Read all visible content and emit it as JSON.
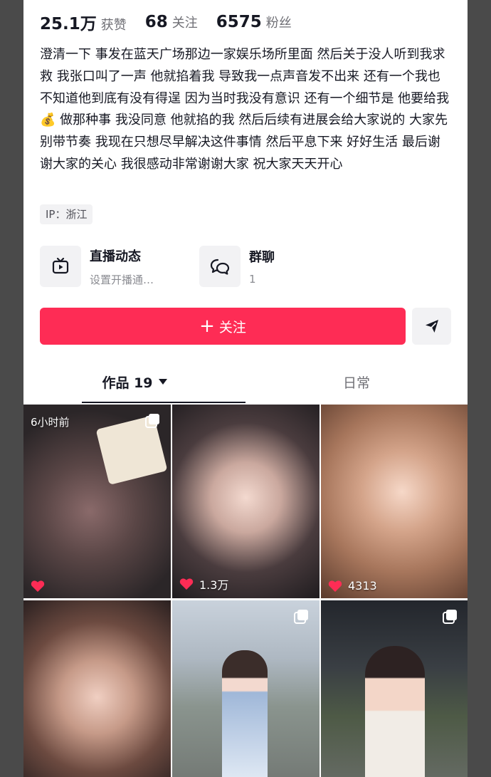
{
  "profile": {
    "stats": [
      {
        "value": "25.1万",
        "label": "获赞"
      },
      {
        "value": "68",
        "label": "关注"
      },
      {
        "value": "6575",
        "label": "粉丝"
      }
    ],
    "bio": "澄清一下 事发在蓝天广场那边一家娱乐场所里面 然后关于没人听到我求救 我张口叫了一声 他就掐着我 导致我一点声音发不出来 还有一个我也不知道他到底有没有得逞 因为当时我没有意识 还有一个细节是 他要给我💰 做那种事 我没同意 他就掐的我 然后后续有进展会给大家说的 大家先别带节奏 我现在只想尽早解决这件事情 然后平息下来 好好生活 最后谢谢大家的关心 我很感动非常谢谢大家 祝大家天天开心",
    "ip": "IP：浙江"
  },
  "features": {
    "live": {
      "title": "直播动态",
      "subtitle": "设置开播通…",
      "icon": "tv-play-icon"
    },
    "group": {
      "title": "群聊",
      "subtitle": "1",
      "icon": "chat-bubbles-icon"
    }
  },
  "actions": {
    "follow_label": "关注",
    "share_icon": "send-icon"
  },
  "tabs": {
    "works": "作品 19",
    "daily": "日常"
  },
  "videos": [
    {
      "time": "6小时前",
      "likes": "",
      "multi": true
    },
    {
      "time": "",
      "likes": "1.3万",
      "multi": false
    },
    {
      "time": "",
      "likes": "4313",
      "multi": false
    },
    {
      "time": "",
      "likes": "",
      "multi": false
    },
    {
      "time": "",
      "likes": "",
      "multi": true
    },
    {
      "time": "",
      "likes": "",
      "multi": true
    }
  ],
  "colors": {
    "accent": "#fe2c55",
    "text": "#161823",
    "muted": "#6f6f75",
    "chip": "#f2f2f4"
  }
}
